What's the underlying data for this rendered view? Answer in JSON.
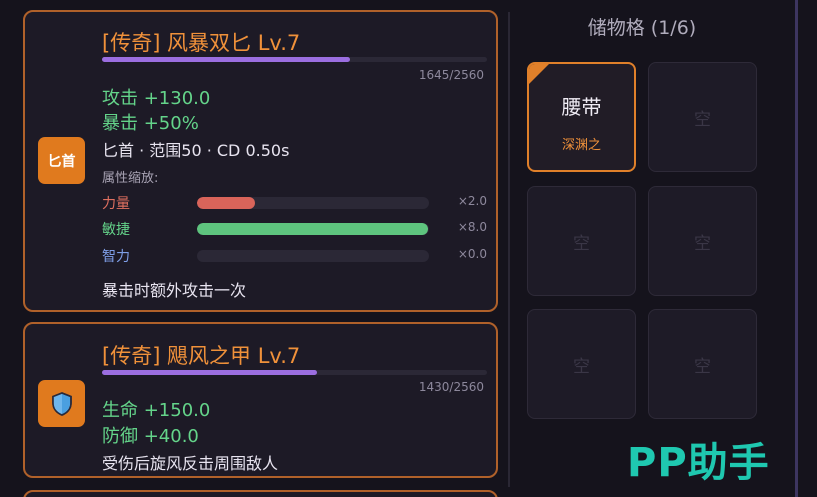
{
  "items": [
    {
      "title": "[传奇] 风暴双匕 Lv.7",
      "type_badge": "匕首",
      "exp_text": "1645/2560",
      "exp_fraction": 0.643,
      "stats": [
        "攻击 +130.0",
        "暴击 +50%"
      ],
      "info": "匕首 · 范围50 · CD 0.50s",
      "scaling_label": "属性缩放:",
      "attributes": [
        {
          "name": "力量",
          "multiplier": "×2.0",
          "fill_fraction": 0.25,
          "color": "#d9645a",
          "name_color": "#e07060"
        },
        {
          "name": "敏捷",
          "multiplier": "×8.0",
          "fill_fraction": 0.995,
          "color": "#5ec47e",
          "name_color": "#64d48a"
        },
        {
          "name": "智力",
          "multiplier": "×0.0",
          "fill_fraction": 0.0,
          "color": "#6a8fe0",
          "name_color": "#7f9fe8"
        }
      ],
      "passive": "暴击时额外攻击一次"
    },
    {
      "title": "[传奇] 飓风之甲 Lv.7",
      "type_badge_icon": "shield-icon",
      "exp_text": "1430/2560",
      "exp_fraction": 0.559,
      "stats": [
        "生命 +150.0",
        "防御 +40.0"
      ],
      "passive": "受伤后旋风反击周围敌人"
    }
  ],
  "storage": {
    "title": "储物格 (1/6)",
    "slots": [
      {
        "name": "腰带",
        "affix": "深渊之",
        "filled": true
      },
      {
        "empty_label": "空",
        "filled": false
      },
      {
        "empty_label": "空",
        "filled": false
      },
      {
        "empty_label": "空",
        "filled": false
      },
      {
        "empty_label": "空",
        "filled": false
      },
      {
        "empty_label": "空",
        "filled": false
      }
    ]
  },
  "colors": {
    "card_border": "#b0612a",
    "title_orange": "#f0913a",
    "stat_green": "#64d48a",
    "exp_purple": "#9b6ee0",
    "badge_orange": "#e07a1e"
  },
  "watermark": "PP助手"
}
